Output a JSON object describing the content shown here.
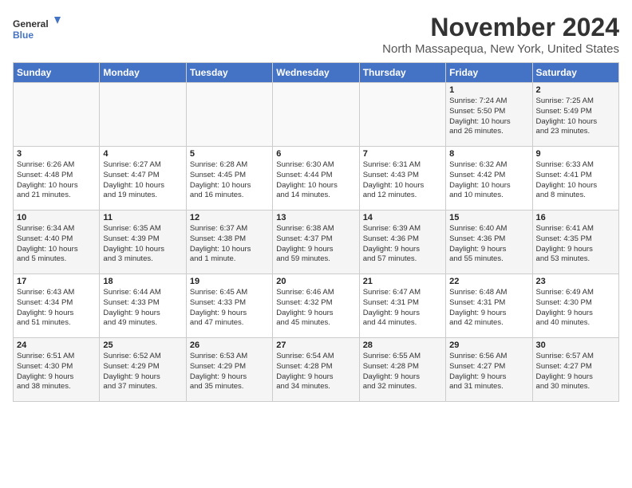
{
  "header": {
    "logo_line1": "General",
    "logo_line2": "Blue",
    "title": "November 2024",
    "subtitle": "North Massapequa, New York, United States"
  },
  "weekdays": [
    "Sunday",
    "Monday",
    "Tuesday",
    "Wednesday",
    "Thursday",
    "Friday",
    "Saturday"
  ],
  "weeks": [
    [
      {
        "day": "",
        "info": ""
      },
      {
        "day": "",
        "info": ""
      },
      {
        "day": "",
        "info": ""
      },
      {
        "day": "",
        "info": ""
      },
      {
        "day": "",
        "info": ""
      },
      {
        "day": "1",
        "info": "Sunrise: 7:24 AM\nSunset: 5:50 PM\nDaylight: 10 hours\nand 26 minutes."
      },
      {
        "day": "2",
        "info": "Sunrise: 7:25 AM\nSunset: 5:49 PM\nDaylight: 10 hours\nand 23 minutes."
      }
    ],
    [
      {
        "day": "3",
        "info": "Sunrise: 6:26 AM\nSunset: 4:48 PM\nDaylight: 10 hours\nand 21 minutes."
      },
      {
        "day": "4",
        "info": "Sunrise: 6:27 AM\nSunset: 4:47 PM\nDaylight: 10 hours\nand 19 minutes."
      },
      {
        "day": "5",
        "info": "Sunrise: 6:28 AM\nSunset: 4:45 PM\nDaylight: 10 hours\nand 16 minutes."
      },
      {
        "day": "6",
        "info": "Sunrise: 6:30 AM\nSunset: 4:44 PM\nDaylight: 10 hours\nand 14 minutes."
      },
      {
        "day": "7",
        "info": "Sunrise: 6:31 AM\nSunset: 4:43 PM\nDaylight: 10 hours\nand 12 minutes."
      },
      {
        "day": "8",
        "info": "Sunrise: 6:32 AM\nSunset: 4:42 PM\nDaylight: 10 hours\nand 10 minutes."
      },
      {
        "day": "9",
        "info": "Sunrise: 6:33 AM\nSunset: 4:41 PM\nDaylight: 10 hours\nand 8 minutes."
      }
    ],
    [
      {
        "day": "10",
        "info": "Sunrise: 6:34 AM\nSunset: 4:40 PM\nDaylight: 10 hours\nand 5 minutes."
      },
      {
        "day": "11",
        "info": "Sunrise: 6:35 AM\nSunset: 4:39 PM\nDaylight: 10 hours\nand 3 minutes."
      },
      {
        "day": "12",
        "info": "Sunrise: 6:37 AM\nSunset: 4:38 PM\nDaylight: 10 hours\nand 1 minute."
      },
      {
        "day": "13",
        "info": "Sunrise: 6:38 AM\nSunset: 4:37 PM\nDaylight: 9 hours\nand 59 minutes."
      },
      {
        "day": "14",
        "info": "Sunrise: 6:39 AM\nSunset: 4:36 PM\nDaylight: 9 hours\nand 57 minutes."
      },
      {
        "day": "15",
        "info": "Sunrise: 6:40 AM\nSunset: 4:36 PM\nDaylight: 9 hours\nand 55 minutes."
      },
      {
        "day": "16",
        "info": "Sunrise: 6:41 AM\nSunset: 4:35 PM\nDaylight: 9 hours\nand 53 minutes."
      }
    ],
    [
      {
        "day": "17",
        "info": "Sunrise: 6:43 AM\nSunset: 4:34 PM\nDaylight: 9 hours\nand 51 minutes."
      },
      {
        "day": "18",
        "info": "Sunrise: 6:44 AM\nSunset: 4:33 PM\nDaylight: 9 hours\nand 49 minutes."
      },
      {
        "day": "19",
        "info": "Sunrise: 6:45 AM\nSunset: 4:33 PM\nDaylight: 9 hours\nand 47 minutes."
      },
      {
        "day": "20",
        "info": "Sunrise: 6:46 AM\nSunset: 4:32 PM\nDaylight: 9 hours\nand 45 minutes."
      },
      {
        "day": "21",
        "info": "Sunrise: 6:47 AM\nSunset: 4:31 PM\nDaylight: 9 hours\nand 44 minutes."
      },
      {
        "day": "22",
        "info": "Sunrise: 6:48 AM\nSunset: 4:31 PM\nDaylight: 9 hours\nand 42 minutes."
      },
      {
        "day": "23",
        "info": "Sunrise: 6:49 AM\nSunset: 4:30 PM\nDaylight: 9 hours\nand 40 minutes."
      }
    ],
    [
      {
        "day": "24",
        "info": "Sunrise: 6:51 AM\nSunset: 4:30 PM\nDaylight: 9 hours\nand 38 minutes."
      },
      {
        "day": "25",
        "info": "Sunrise: 6:52 AM\nSunset: 4:29 PM\nDaylight: 9 hours\nand 37 minutes."
      },
      {
        "day": "26",
        "info": "Sunrise: 6:53 AM\nSunset: 4:29 PM\nDaylight: 9 hours\nand 35 minutes."
      },
      {
        "day": "27",
        "info": "Sunrise: 6:54 AM\nSunset: 4:28 PM\nDaylight: 9 hours\nand 34 minutes."
      },
      {
        "day": "28",
        "info": "Sunrise: 6:55 AM\nSunset: 4:28 PM\nDaylight: 9 hours\nand 32 minutes."
      },
      {
        "day": "29",
        "info": "Sunrise: 6:56 AM\nSunset: 4:27 PM\nDaylight: 9 hours\nand 31 minutes."
      },
      {
        "day": "30",
        "info": "Sunrise: 6:57 AM\nSunset: 4:27 PM\nDaylight: 9 hours\nand 30 minutes."
      }
    ]
  ]
}
